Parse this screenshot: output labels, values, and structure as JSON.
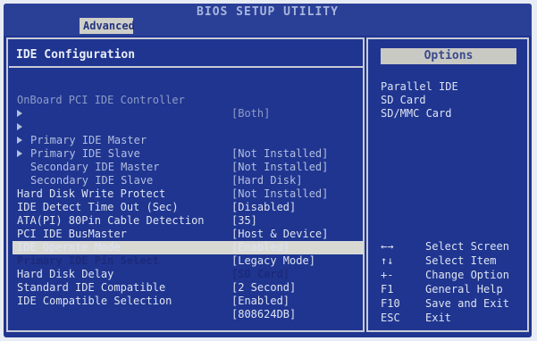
{
  "window": {
    "title": "BIOS SETUP UTILITY"
  },
  "tabs": {
    "advanced": "Advanced"
  },
  "section": {
    "title": "IDE Configuration"
  },
  "settings": [
    {
      "label": "OnBoard PCI IDE Controller",
      "value": "[Both]"
    },
    {
      "label": "Primary IDE Master",
      "value": "[Not Installed]"
    },
    {
      "label": "Primary IDE Slave",
      "value": "[Not Installed]"
    },
    {
      "label": "Secondary IDE Master",
      "value": "[Hard Disk]"
    },
    {
      "label": "Secondary IDE Slave",
      "value": "[Not Installed]"
    },
    {
      "label": "Hard Disk Write Protect",
      "value": "[Disabled]"
    },
    {
      "label": "IDE Detect Time Out (Sec)",
      "value": "[35]"
    },
    {
      "label": "ATA(PI) 80Pin Cable Detection",
      "value": "[Host & Device]"
    },
    {
      "label": "PCI IDE BusMaster",
      "value": "[Enabled]"
    },
    {
      "label": "IDE Operate Mode",
      "value": "[Legacy Mode]"
    },
    {
      "label": "Primary IDE Pin Select",
      "value": "[SD Card]"
    },
    {
      "label": "Hard Disk Delay",
      "value": "[2 Second]"
    },
    {
      "label": "Standard IDE Compatible",
      "value": "[Enabled]"
    },
    {
      "label": "IDE Compatible Selection",
      "value": "[808624DB]"
    }
  ],
  "options": {
    "header": "Options",
    "items": [
      "Parallel IDE",
      "SD Card",
      "SD/MMC Card"
    ]
  },
  "help": [
    {
      "key": "←→",
      "desc": "Select Screen"
    },
    {
      "key": "↑↓",
      "desc": "Select Item"
    },
    {
      "key": "+-",
      "desc": "Change Option"
    },
    {
      "key": "F1",
      "desc": "General Help"
    },
    {
      "key": "F10",
      "desc": "Save and Exit"
    },
    {
      "key": "ESC",
      "desc": "Exit"
    }
  ],
  "colors": {
    "background": "#1f3590",
    "highlight": "#d9d9d4",
    "text": "#dde3f1",
    "dim_text": "#8e9bc8"
  }
}
